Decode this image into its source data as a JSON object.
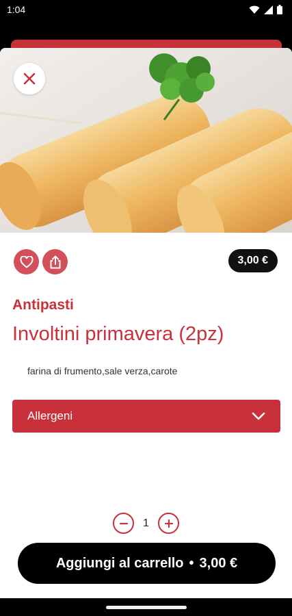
{
  "status_bar": {
    "time": "1:04"
  },
  "product": {
    "category": "Antipasti",
    "name": "Involtini primavera (2pz)",
    "ingredients": "farina di frumento,sale verza,carote",
    "price": "3,00 €"
  },
  "allergens": {
    "label": "Allergeni"
  },
  "quantity": {
    "value": "1"
  },
  "cart_button": {
    "label": "Aggiungi al carrello",
    "separator": "•",
    "price": "3,00 €"
  },
  "colors": {
    "accent": "#c8313a",
    "dark": "#111111"
  }
}
